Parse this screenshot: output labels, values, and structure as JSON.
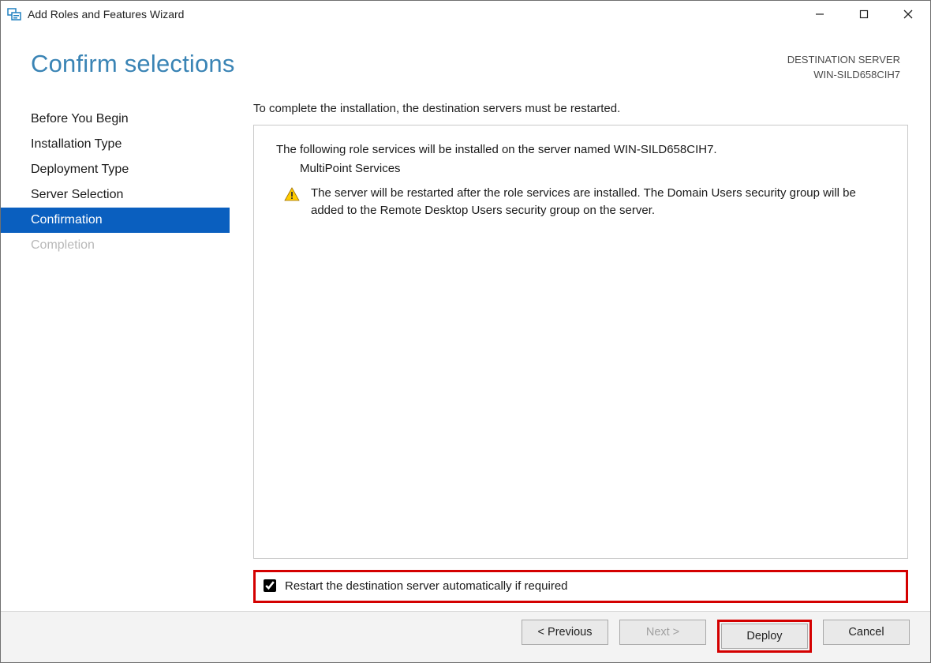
{
  "window_title": "Add Roles and Features Wizard",
  "header": {
    "title": "Confirm selections",
    "dest_label": "DESTINATION SERVER",
    "dest_name": "WIN-SILD658CIH7"
  },
  "sidebar": {
    "steps": [
      {
        "label": "Before You Begin",
        "state": "normal"
      },
      {
        "label": "Installation Type",
        "state": "normal"
      },
      {
        "label": "Deployment Type",
        "state": "normal"
      },
      {
        "label": "Server Selection",
        "state": "normal"
      },
      {
        "label": "Confirmation",
        "state": "active"
      },
      {
        "label": "Completion",
        "state": "disabled"
      }
    ]
  },
  "main": {
    "instruction": "To complete the installation, the destination servers must be restarted.",
    "intro_line": "The following role services will be installed on the server named WIN-SILD658CIH7.",
    "service_name": "MultiPoint Services",
    "warning_text": "The server will be restarted after the role services are installed. The Domain Users security group will be added to the Remote Desktop Users security group on the server.",
    "checkbox_label": "Restart the destination server automatically if required",
    "checkbox_checked": true
  },
  "footer": {
    "previous": "< Previous",
    "next": "Next >",
    "deploy": "Deploy",
    "cancel": "Cancel"
  },
  "icons": {
    "warning": "warning-triangle-icon",
    "app": "server-manager-icon"
  }
}
